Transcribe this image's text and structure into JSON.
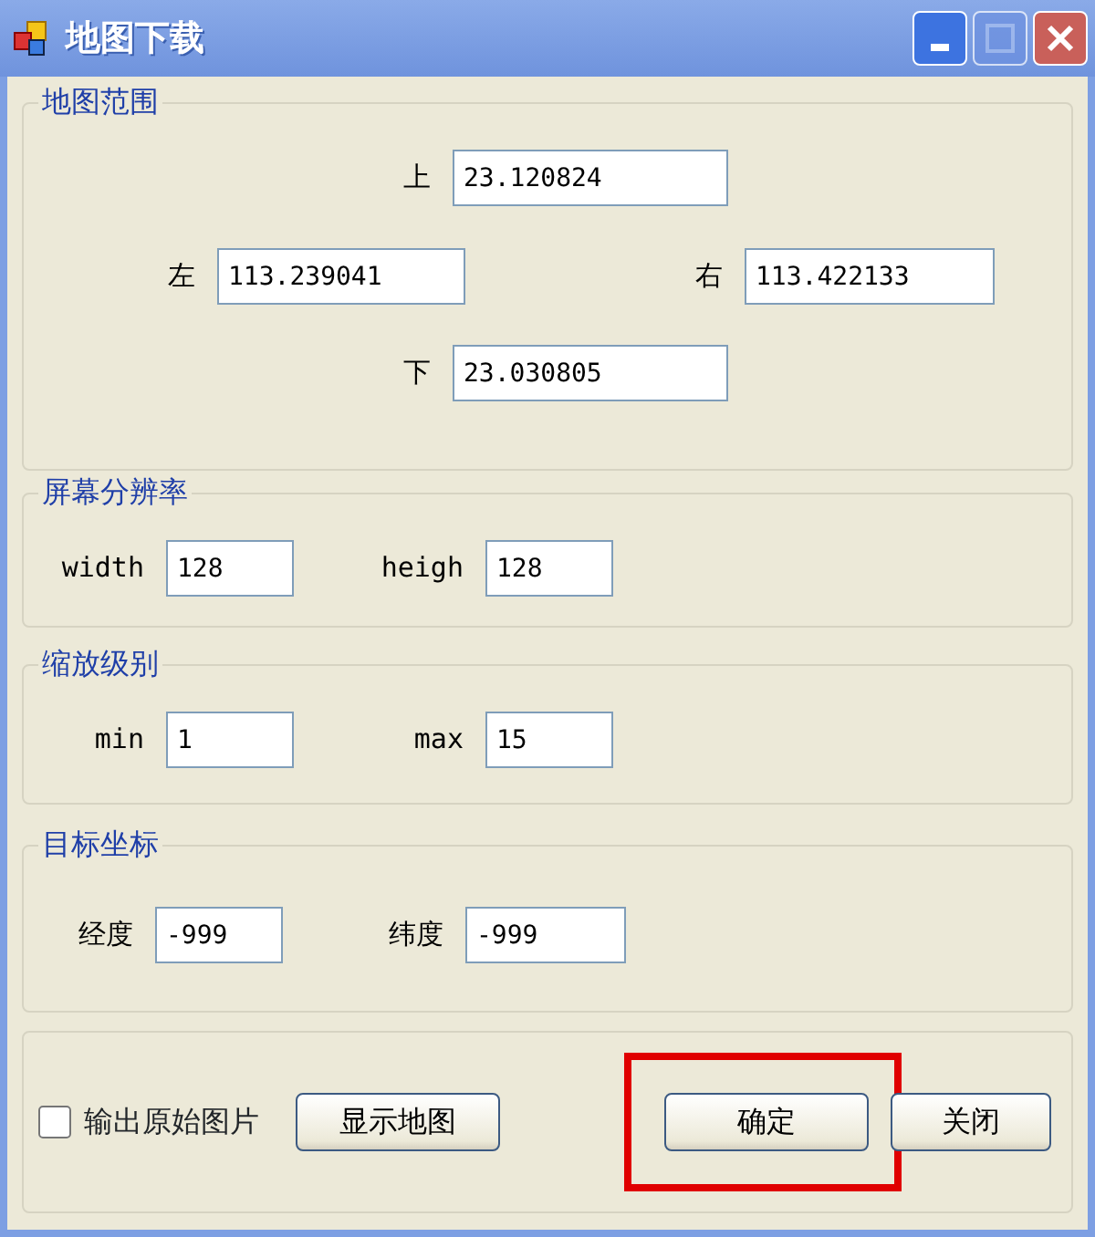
{
  "window": {
    "title": "地图下载"
  },
  "groups": [
    {
      "title": "地图范围",
      "kind": "extent",
      "fields": [
        {
          "label": "上",
          "value": "23.120824"
        },
        {
          "label": "左",
          "value": "113.239041"
        },
        {
          "label": "右",
          "value": "113.422133"
        },
        {
          "label": "下",
          "value": "23.030805"
        }
      ]
    },
    {
      "title": "屏幕分辨率",
      "kind": "pair",
      "fields": [
        {
          "label": "width",
          "value": "128"
        },
        {
          "label": "heigh",
          "value": "128"
        }
      ]
    },
    {
      "title": "缩放级别",
      "kind": "pair",
      "fields": [
        {
          "label": "min",
          "value": "1"
        },
        {
          "label": "max",
          "value": "15"
        }
      ]
    },
    {
      "title": "目标坐标",
      "kind": "pair",
      "fields": [
        {
          "label": "经度",
          "value": "-999"
        },
        {
          "label": "纬度",
          "value": "-999"
        }
      ]
    }
  ],
  "footer": {
    "checkbox": {
      "label": "输出原始图片",
      "checked": false
    },
    "buttons": [
      {
        "label": "显示地图",
        "highlighted": false
      },
      {
        "label": "确定",
        "highlighted": true
      },
      {
        "label": "关闭",
        "highlighted": false
      }
    ]
  }
}
